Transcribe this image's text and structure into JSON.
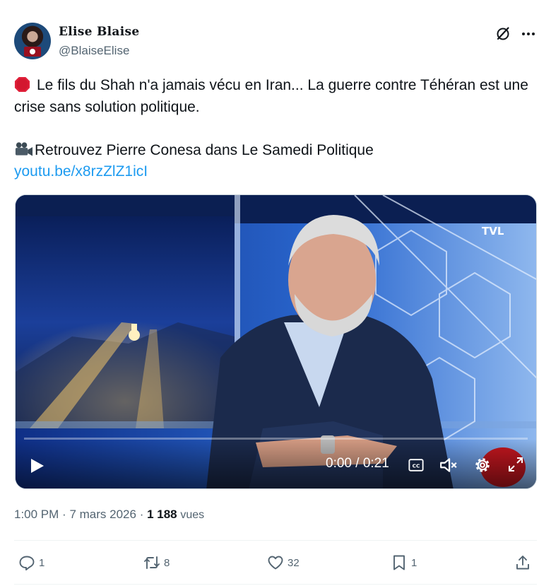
{
  "author": {
    "display_name": "Elise Blaise",
    "handle": "@BlaiseElise",
    "avatar_icon": "avatar-photo"
  },
  "tweet": {
    "line1": "Le fils du Shah n'a jamais vécu en Iran... La guerre contre Téhéran est une crise sans solution politique.",
    "line2": "Retrouvez Pierre Conesa dans Le Samedi Politique",
    "link": "youtu.be/x8rzZlZ1icI",
    "line1_icon": "stop-sign-icon",
    "line2_icon": "movie-camera-icon"
  },
  "video": {
    "channel_logo": "TVL",
    "time_display": "0:00 / 0:21",
    "progress": 0.0
  },
  "meta": {
    "time": "1:00 PM",
    "separator": "·",
    "date": "7 mars 2026",
    "views_count": "1 188",
    "views_label": "vues"
  },
  "actions": {
    "replies": "1",
    "reposts": "8",
    "likes": "32",
    "bookmarks": "1"
  },
  "colors": {
    "text": "#0f1419",
    "secondary": "#536471",
    "link": "#1d9bf0",
    "border": "#cfd9de"
  }
}
